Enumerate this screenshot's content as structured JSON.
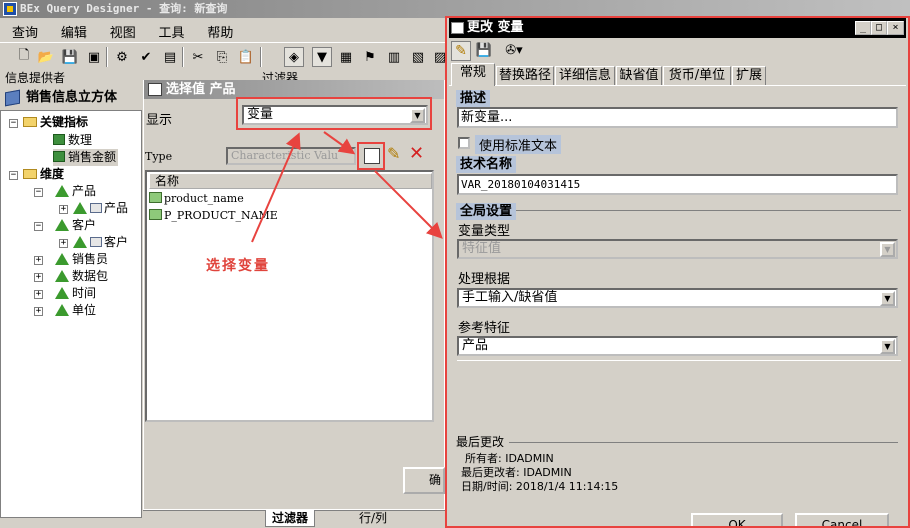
{
  "main_window": {
    "title": "BEx Query Designer - 查询: 新查询",
    "menu": [
      "查询",
      "编辑",
      "视图",
      "工具",
      "帮助"
    ]
  },
  "info_provider": {
    "header": "信息提供者",
    "cube_name": "销售信息立方体",
    "tree": {
      "key_figures_folder": "关键指标",
      "key_figures": [
        "数理",
        "销售金额"
      ],
      "dimensions_folder": "维度",
      "dim_product": "产品",
      "char_product": "产品",
      "dim_customer": "客户",
      "char_customer": "客户",
      "other_dimensions": [
        "销售员",
        "数据包",
        "时间",
        "单位"
      ]
    }
  },
  "background_label": "过滤器",
  "select_dialog": {
    "title": "选择值 产品",
    "display_label": "显示",
    "display_value": "变量",
    "type_label": "Type",
    "type_value": "Characteristic Valu",
    "list_header": "名称",
    "list_items": [
      "product_name",
      "P_PRODUCT_NAME"
    ],
    "button_partial": "确"
  },
  "annotation": {
    "text": "选择变量"
  },
  "bottom_tabs": [
    "过滤器",
    "行/列"
  ],
  "change_dialog": {
    "title": "更改 变量",
    "tabs": [
      "常规",
      "替换路径",
      "详细信息",
      "缺省值",
      "货币/单位",
      "扩展"
    ],
    "active_tab": "常规",
    "description_head": "描述",
    "description_value": "新变量...",
    "use_std_text": "使用标准文本",
    "tech_name_head": "技术名称",
    "tech_name_value": "VAR_20180104031415",
    "global_settings_head": "全局设置",
    "var_type_label": "变量类型",
    "var_type_value": "特征值",
    "processing_label": "处理根据",
    "processing_value": "手工输入/缺省值",
    "ref_char_label": "参考特征",
    "ref_char_value": "产品",
    "last_changed_head": "最后更改",
    "owner_line": "所有者: IDADMIN",
    "last_changer_line": "最后更改者: IDADMIN",
    "datetime_line": "日期/时间: 2018/1/4 11:14:15",
    "ok_partial": "OK",
    "cancel_partial": "Cancel"
  },
  "colors": {
    "annotation_red": "#e8433f",
    "section_head_bg": "#b6c4da",
    "active_title_bg": "#000000"
  }
}
